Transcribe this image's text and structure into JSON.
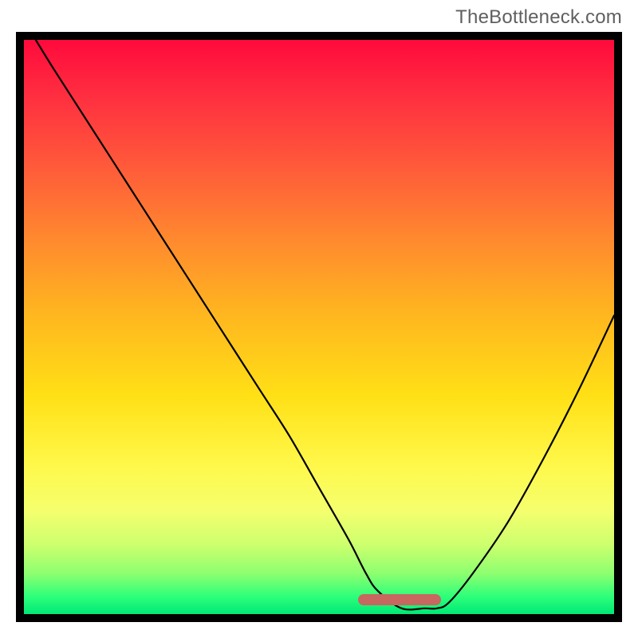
{
  "watermark": "TheBottleneck.com",
  "chart_data": {
    "type": "line",
    "title": "",
    "xlabel": "",
    "ylabel": "",
    "xlim": [
      0,
      100
    ],
    "ylim": [
      0,
      100
    ],
    "grid": false,
    "legend": false,
    "series": [
      {
        "name": "bottleneck-curve",
        "x": [
          2,
          5,
          10,
          15,
          20,
          25,
          30,
          35,
          40,
          45,
          50,
          55,
          58,
          60,
          64,
          68,
          70,
          72,
          76,
          82,
          88,
          94,
          100
        ],
        "y": [
          100,
          95,
          87,
          79,
          71,
          63,
          55,
          47,
          39,
          31,
          22,
          13,
          7,
          4,
          1,
          1,
          1,
          2,
          7,
          16,
          27,
          39,
          52
        ]
      }
    ],
    "annotations": [
      {
        "name": "valley-highlight",
        "x_start": 58,
        "x_end": 72,
        "y": 1,
        "color": "#c86660"
      }
    ],
    "background_gradient": {
      "direction": "vertical",
      "stops": [
        {
          "pos": 0.0,
          "color": "#ff0a3c"
        },
        {
          "pos": 0.1,
          "color": "#ff2f40"
        },
        {
          "pos": 0.22,
          "color": "#ff5a3a"
        },
        {
          "pos": 0.35,
          "color": "#ff8a2e"
        },
        {
          "pos": 0.48,
          "color": "#ffb71f"
        },
        {
          "pos": 0.62,
          "color": "#ffe016"
        },
        {
          "pos": 0.74,
          "color": "#fff84a"
        },
        {
          "pos": 0.82,
          "color": "#f5ff6e"
        },
        {
          "pos": 0.88,
          "color": "#ccff6e"
        },
        {
          "pos": 0.93,
          "color": "#8cff70"
        },
        {
          "pos": 0.97,
          "color": "#2cff7a"
        },
        {
          "pos": 1.0,
          "color": "#00e876"
        }
      ]
    }
  }
}
